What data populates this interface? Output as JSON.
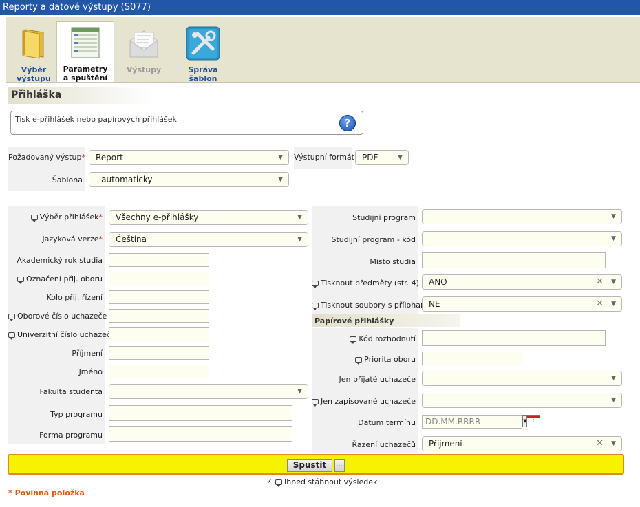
{
  "window": {
    "title": "Reporty a datové výstupy (S077)"
  },
  "tabs": [
    {
      "label1": "Výběr",
      "label2": "výstupu"
    },
    {
      "label1": "Parametry",
      "label2": "a spuštění"
    },
    {
      "label1": "Výstupy",
      "label2": ""
    },
    {
      "label1": "Správa",
      "label2": "šablon"
    }
  ],
  "section": {
    "title": "Přihláška",
    "description": "Tisk e-přihlášek nebo papírových přihlášek",
    "help_icon": "?"
  },
  "top": {
    "output_label": "Požadovaný výstup",
    "output_value": "Report",
    "format_label": "Výstupní formát",
    "format_value": "PDF",
    "template_label": "Šablona",
    "template_value": "- automaticky -"
  },
  "left": {
    "selection_label": "Výběr přihlášek",
    "selection_value": "Všechny e-přihlášky",
    "language_label": "Jazyková verze",
    "language_value": "Čeština",
    "year_label": "Akademický rok studia",
    "field_mark_label": "Označení přij. oboru",
    "round_label": "Kolo přij. řízení",
    "field_number_label": "Oborové číslo uchazeče",
    "uni_number_label": "Univerzitní číslo uchazeče",
    "surname_label": "Příjmení",
    "name_label": "Jméno",
    "faculty_label": "Fakulta studenta",
    "program_type_label": "Typ programu",
    "program_form_label": "Forma programu"
  },
  "right": {
    "program_label": "Studijní program",
    "program_code_label": "Studijní program - kód",
    "place_label": "Místo studia",
    "print_subjects_label": "Tisknout předměty (str. 4)",
    "print_subjects_value": "ANO",
    "print_files_label": "Tisknout soubory s přílohami",
    "print_files_value": "NE",
    "paper_title": "Papírové přihlášky",
    "decision_code_label": "Kód rozhodnutí",
    "priority_label": "Priorita oboru",
    "accepted_label": "Jen přijaté uchazeče",
    "enrolled_label": "Jen zapisované uchazeče",
    "date_label": "Datum termínu",
    "date_placeholder": "DD.MM.RRRR",
    "sort_label": "Řazení uchazečů",
    "sort_value": "Příjmení"
  },
  "actions": {
    "run_label": "Spustit",
    "more_label": "...",
    "download_label": "Ihned stáhnout výsledek",
    "required_note": "* Povinná položka"
  },
  "symbols": {
    "required": "*",
    "arrow": "▼",
    "clear": "✕"
  }
}
